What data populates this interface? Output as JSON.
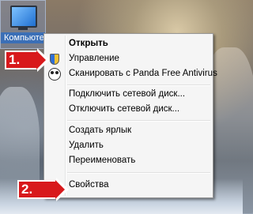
{
  "desktop": {
    "icon_label": "Компьютер"
  },
  "menu": {
    "items": [
      {
        "label": "Открыть",
        "bold": true
      },
      {
        "label": "Управление",
        "icon": "uac-shield-icon"
      },
      {
        "label": "Сканировать с Panda Free Antivirus",
        "icon": "panda-icon"
      },
      {
        "label": "Подключить сетевой диск..."
      },
      {
        "label": "Отключить сетевой диск..."
      },
      {
        "label": "Создать ярлык"
      },
      {
        "label": "Удалить"
      },
      {
        "label": "Переименовать"
      },
      {
        "label": "Свойства"
      }
    ]
  },
  "annotations": {
    "step1": "1.",
    "step2": "2."
  },
  "colors": {
    "step_badge": "#d8191c",
    "menu_bg": "#f5f5f5"
  }
}
